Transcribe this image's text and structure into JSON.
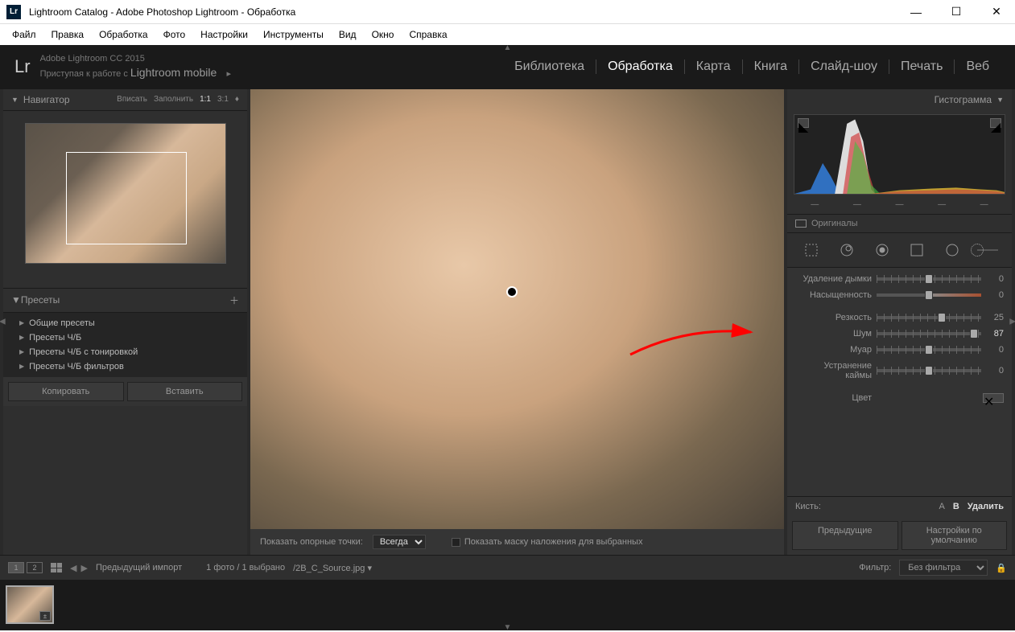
{
  "titlebar": {
    "title": "Lightroom Catalog - Adobe Photoshop Lightroom - Обработка",
    "logo": "Lr"
  },
  "menubar": [
    "Файл",
    "Правка",
    "Обработка",
    "Фото",
    "Настройки",
    "Инструменты",
    "Вид",
    "Окно",
    "Справка"
  ],
  "header": {
    "logo": "Lr",
    "line1": "Adobe Lightroom CC 2015",
    "line2_a": "Приступая к работе с ",
    "line2_b": "Lightroom mobile"
  },
  "modules": [
    "Библиотека",
    "Обработка",
    "Карта",
    "Книга",
    "Слайд-шоу",
    "Печать",
    "Веб"
  ],
  "active_module": "Обработка",
  "navigator": {
    "title": "Навигатор",
    "zoom": {
      "fit": "Вписать",
      "fill": "Заполнить",
      "r11": "1:1",
      "r31": "3:1"
    }
  },
  "presets": {
    "title": "Пресеты",
    "items": [
      "Общие пресеты",
      "Пресеты Ч/Б",
      "Пресеты Ч/Б с тонировкой",
      "Пресеты Ч/Б фильтров"
    ]
  },
  "left_buttons": {
    "copy": "Копировать",
    "paste": "Вставить"
  },
  "center_toolbar": {
    "anchor_label": "Показать опорные точки:",
    "anchor_value": "Всегда",
    "mask_label": "Показать маску наложения для выбранных"
  },
  "histogram": {
    "title": "Гистограмма",
    "originals": "Оригиналы",
    "ticks": [
      "—",
      "—",
      "—",
      "—",
      "—"
    ]
  },
  "sliders": {
    "dehaze": {
      "label": "Удаление дымки",
      "value": 0,
      "pos": 50
    },
    "saturation": {
      "label": "Насыщенность",
      "value": 0,
      "pos": 50
    },
    "sharpness": {
      "label": "Резкость",
      "value": 25,
      "pos": 62
    },
    "noise": {
      "label": "Шум",
      "value": 87,
      "pos": 93
    },
    "moire": {
      "label": "Муар",
      "value": 0,
      "pos": 50
    },
    "defringe": {
      "label": "Устранение каймы",
      "value": 0,
      "pos": 50
    },
    "color": {
      "label": "Цвет"
    }
  },
  "brush": {
    "label": "Кисть:",
    "a": "А",
    "b": "В",
    "delete": "Удалить"
  },
  "right_buttons": {
    "prev": "Предыдущие",
    "defaults": "Настройки по умолчанию"
  },
  "filmstrip": {
    "view1": "1",
    "view2": "2",
    "src_label": "Предыдущий импорт",
    "count": "1 фото / 1 выбрано",
    "filename": "/2B_C_Source.jpg",
    "filter_label": "Фильтр:",
    "filter_value": "Без фильтра"
  }
}
